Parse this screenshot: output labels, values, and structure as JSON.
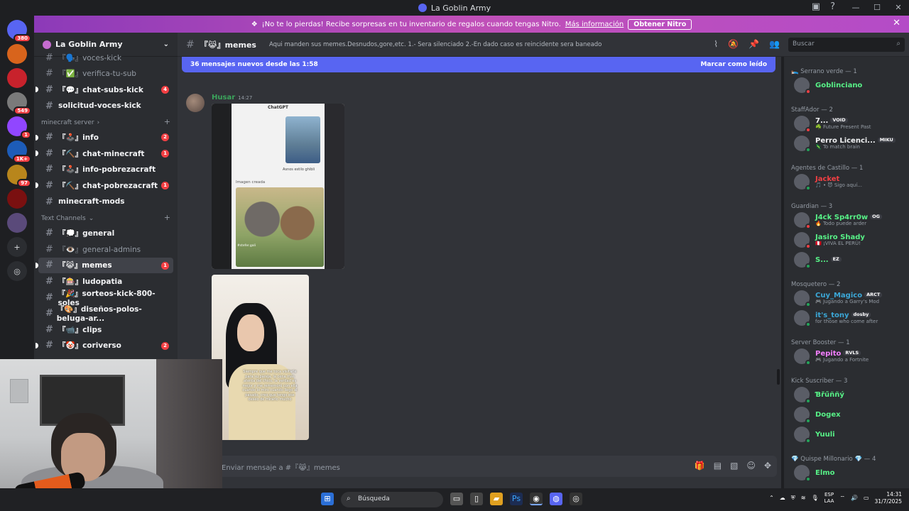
{
  "window": {
    "title": "La Goblin Army"
  },
  "guilds": [
    {
      "badge": "380"
    },
    {
      "badge": ""
    },
    {
      "badge": ""
    },
    {
      "badge": "549"
    },
    {
      "badge": "1"
    },
    {
      "badge": "1K+"
    },
    {
      "badge": "97"
    },
    {
      "badge": ""
    },
    {
      "badge": ""
    }
  ],
  "nitro": {
    "text": "¡No te lo pierdas! Recibe sorpresas en tu inventario de regalos cuando tengas Nitro.",
    "link": "Más información",
    "button": "Obtener Nitro"
  },
  "server": {
    "name": "La Goblin Army"
  },
  "channels_top": [
    {
      "name": "『🗣️』voces-kick",
      "badge": "",
      "state": "muted"
    },
    {
      "name": "『✅』verifica-tu-sub",
      "badge": "",
      "state": "muted"
    },
    {
      "name": "『💬』chat-subs-kick",
      "badge": "4",
      "state": "bright"
    },
    {
      "name": "solicitud-voces-kick",
      "badge": "",
      "state": "bright"
    }
  ],
  "category_minecraft": "minecraft server",
  "channels_minecraft": [
    {
      "name": "『🕹️』info",
      "badge": "2",
      "state": "bright"
    },
    {
      "name": "『⛏️』chat-minecraft",
      "badge": "1",
      "state": "bright"
    },
    {
      "name": "『🕹️』info-pobrezacraft",
      "badge": "",
      "state": "bright"
    },
    {
      "name": "『⛏️』chat-pobrezacraft",
      "badge": "1",
      "state": "bright"
    },
    {
      "name": "minecraft-mods",
      "badge": "",
      "state": "bright"
    }
  ],
  "category_text": "Text Channels",
  "channels_text": [
    {
      "name": "『💭』general",
      "badge": "",
      "state": "bright"
    },
    {
      "name": "『👁️』general-admins",
      "badge": "",
      "state": "muted"
    },
    {
      "name": "『😹』memes",
      "badge": "1",
      "state": "active"
    },
    {
      "name": "『🎰』ludopatia",
      "badge": "",
      "state": "bright"
    },
    {
      "name": "『🎉』sorteos-kick-800-soles",
      "badge": "",
      "state": "bright"
    },
    {
      "name": "『🎨』diseños-polos-beluga-ar...",
      "badge": "",
      "state": "bright"
    },
    {
      "name": "『📹』clips",
      "badge": "",
      "state": "bright"
    },
    {
      "name": "『🤡』coriverso",
      "badge": "2",
      "state": "bright"
    }
  ],
  "chat_header": {
    "channel": "『😹』memes",
    "topic": "Aqui manden sus memes.Desnudos,gore,etc. 1.- Sera silenciado 2.-En dado caso es reincidente sera baneado"
  },
  "search": {
    "placeholder": "Buscar"
  },
  "new_messages": {
    "text": "36 mensajes nuevos desde las 1:58",
    "mark": "Marcar como leído"
  },
  "message": {
    "author": "Husar",
    "time": "14:27",
    "image1_title": "ChatGPT",
    "image1_caption": "Asnos estilo ghibli",
    "image1_created": "Imagen creada",
    "image1_tag": "#stefer.gali",
    "image2_text": "Siempre que me toca visitarle para su pareja, la cena más atenta del chico, la verdad es mejor y me rememoró con ella cuando lo miro cuando llegó al pasado, creo que tengo ese deseo de mirarlo mucho"
  },
  "composer": {
    "placeholder": "Enviar mensaje a #『😹』memes"
  },
  "members": [
    {
      "role": "🛌 Serrano verde — 1",
      "people": [
        {
          "name": "Goblinciano",
          "status": "",
          "color": "#57f287",
          "badge": "",
          "presence": "dnd"
        }
      ]
    },
    {
      "role": "StaffAdor — 2",
      "people": [
        {
          "name": "7...",
          "status": "☘️ Future Present Past",
          "color": "#f2f3f5",
          "badge": "VOID",
          "presence": "dnd"
        },
        {
          "name": "Perro Licenci...",
          "status": "🦎 To match brain",
          "color": "#f2f3f5",
          "badge": "MIKU",
          "presence": "online"
        }
      ]
    },
    {
      "role": "Agentes de Castillo — 1",
      "people": [
        {
          "name": "Jacket",
          "status": "🎵 • 😈 Sigo aquí...",
          "color": "#f23f43",
          "badge": "",
          "presence": "online"
        }
      ]
    },
    {
      "role": "Guardian — 3",
      "people": [
        {
          "name": "J4ck Sp4rr0w",
          "status": "🔥 Todo puede arder",
          "color": "#57f287",
          "badge": "OG",
          "presence": "dnd"
        },
        {
          "name": "Jasiro Shady",
          "status": "🇵🇪 ¡VIVA EL PERÚ!",
          "color": "#57f287",
          "badge": "",
          "presence": "dnd"
        },
        {
          "name": "S...",
          "status": "",
          "color": "#57f287",
          "badge": "EZ",
          "presence": "online"
        }
      ]
    },
    {
      "role": "Mosquetero — 2",
      "people": [
        {
          "name": "Cuy_Magico",
          "status": "🎮 Jugando a Garry's Mod",
          "color": "#3ba8d8",
          "badge": "ARCT",
          "presence": "online"
        },
        {
          "name": "͏͏it's_tony",
          "status": "for those who come after",
          "color": "#3ba8d8",
          "badge": "dosby",
          "presence": "online"
        }
      ]
    },
    {
      "role": "Server Booster — 1",
      "people": [
        {
          "name": "Pepito",
          "status": "🎮 Jugando a Fortnite",
          "color": "#f47fff",
          "badge": "RVLS",
          "presence": "online"
        }
      ]
    },
    {
      "role": "Kick Suscriber — 3",
      "people": [
        {
          "name": "Ɓřűññý",
          "status": "",
          "color": "#57f287",
          "badge": "",
          "presence": "online"
        },
        {
          "name": "Dogex",
          "status": "",
          "color": "#57f287",
          "badge": "",
          "presence": "online"
        },
        {
          "name": "Yuuli",
          "status": "",
          "color": "#57f287",
          "badge": "",
          "presence": "online"
        }
      ]
    },
    {
      "role": "💎 Quispe Millonario 💎 — 4",
      "people": [
        {
          "name": "Elmo",
          "status": "",
          "color": "#57f287",
          "badge": "",
          "presence": "online"
        }
      ]
    }
  ],
  "taskbar": {
    "search": "Búsqueda",
    "lang1": "ESP",
    "lang2": "LAA",
    "time": "14:31",
    "date": "31/7/2025"
  }
}
